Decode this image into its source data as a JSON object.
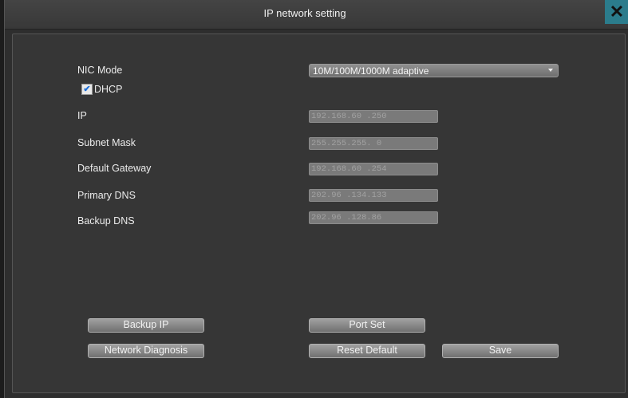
{
  "window": {
    "title": "IP network setting",
    "close_icon": "close-icon"
  },
  "form": {
    "nic_mode": {
      "label": "NIC Mode",
      "value": "10M/100M/1000M  adaptive"
    },
    "dhcp": {
      "label": "DHCP",
      "checked": true
    },
    "ip": {
      "label": "IP",
      "value": "192.168.60 .250"
    },
    "subnet_mask": {
      "label": "Subnet Mask",
      "value": "255.255.255. 0"
    },
    "default_gateway": {
      "label": "Default Gateway",
      "value": "192.168.60 .254"
    },
    "primary_dns": {
      "label": "Primary DNS",
      "value": "202.96 .134.133"
    },
    "backup_dns": {
      "label": "Backup DNS",
      "value": "202.96 .128.86"
    }
  },
  "buttons": {
    "backup_ip": "Backup IP",
    "port_set": "Port Set",
    "network_diagnosis": "Network Diagnosis",
    "reset_default": "Reset Default",
    "save": "Save"
  },
  "colors": {
    "close_button": "#2b7c8c",
    "checkmark": "#1e6fd8"
  }
}
